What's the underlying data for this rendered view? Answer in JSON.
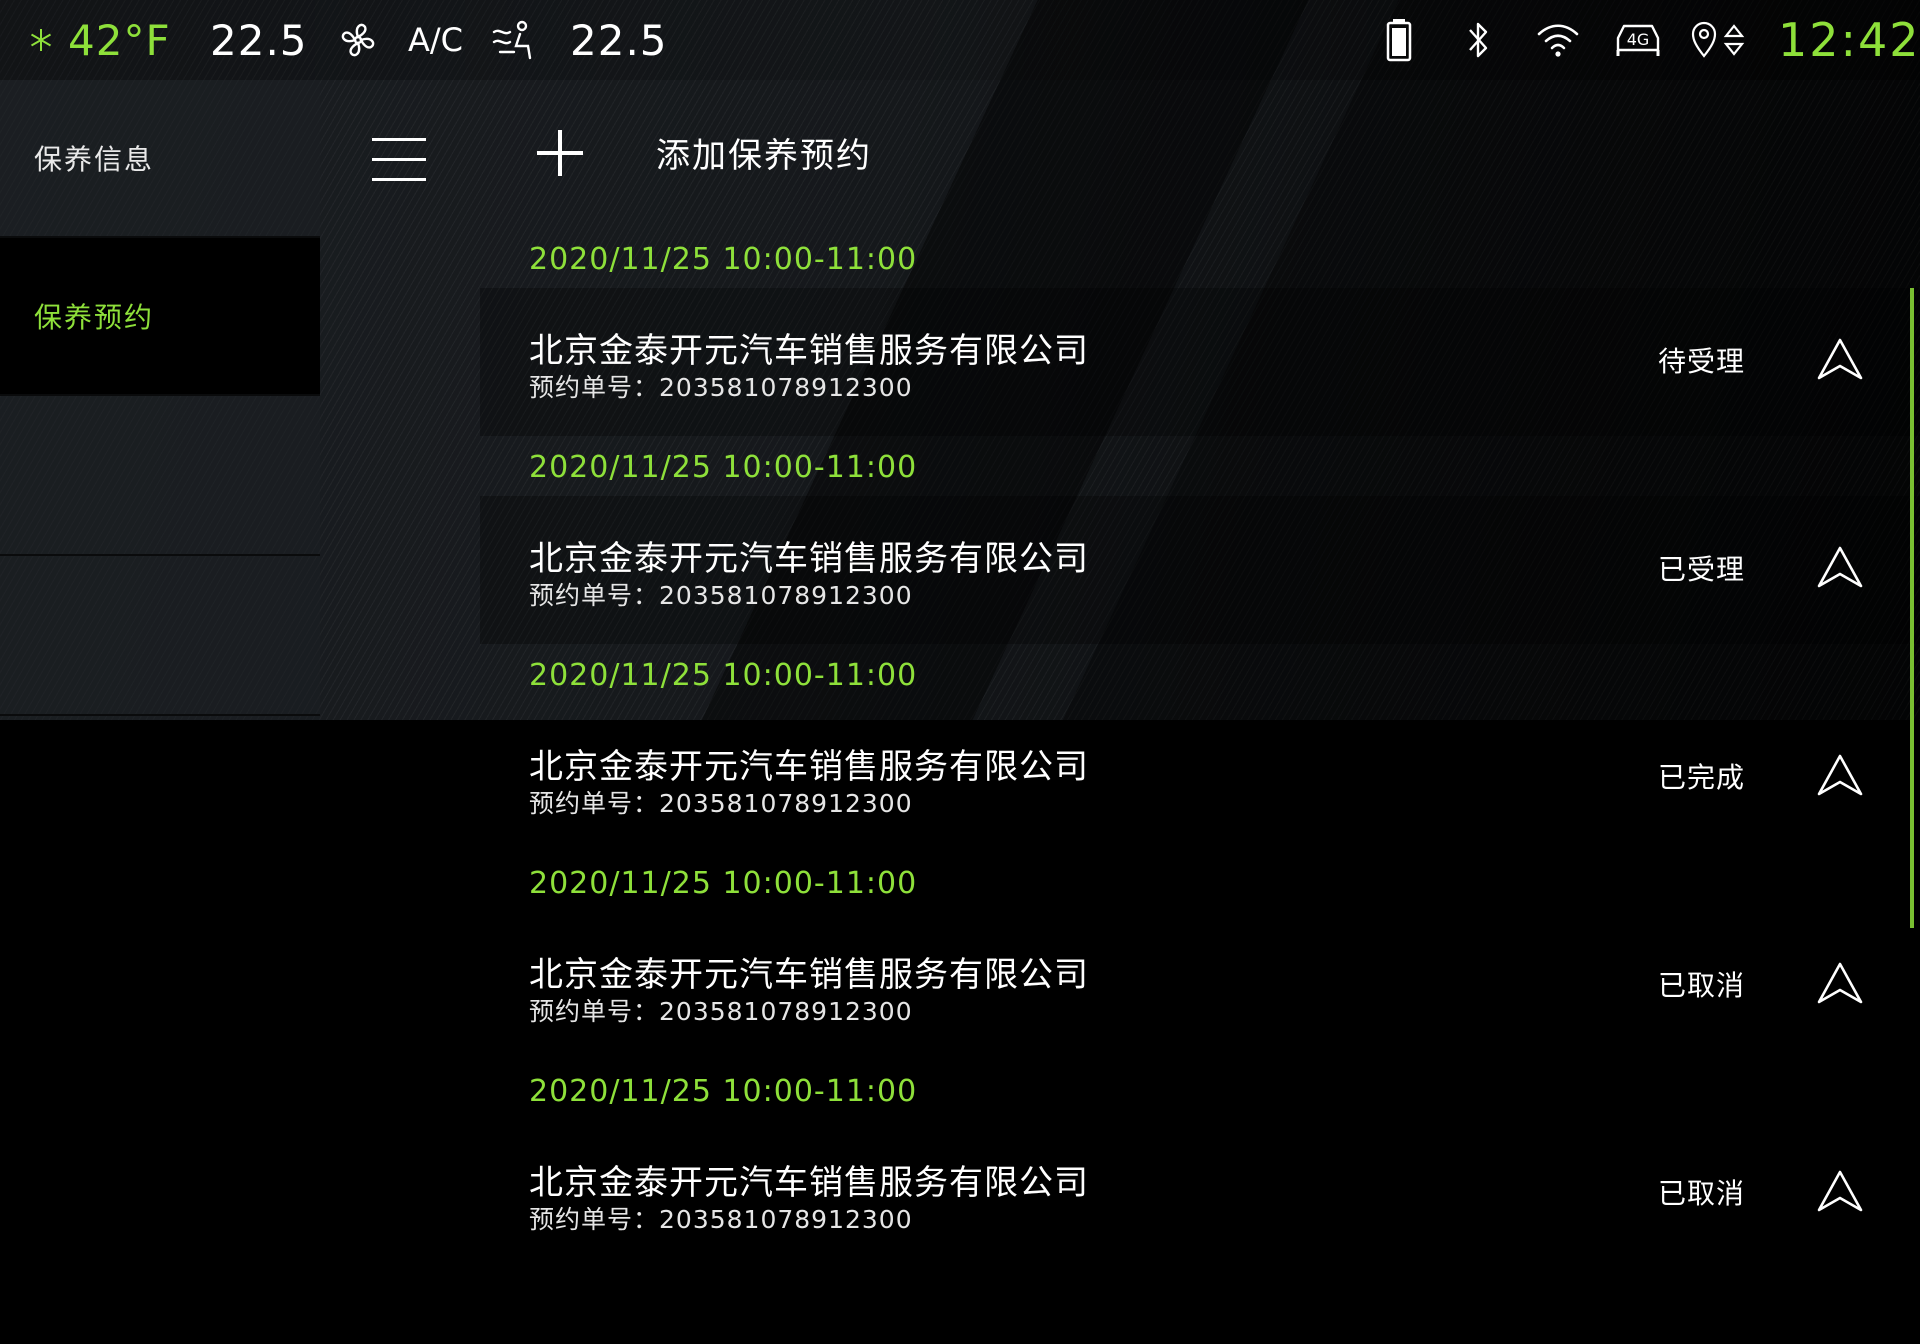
{
  "status_bar": {
    "outside_temp": "42°F",
    "left_temp": "22.5",
    "ac_label": "A/C",
    "right_temp": "22.5",
    "time": "12:42",
    "network_label": "4G"
  },
  "sidebar": {
    "items": [
      {
        "label": "保养信息",
        "active": false
      },
      {
        "label": "保养预约",
        "active": true
      }
    ]
  },
  "toolbar": {
    "add_label": "添加保养预约"
  },
  "appointments": [
    {
      "date": "2020/11/25 10:00-11:00",
      "company": "北京金泰开元汽车销售服务有限公司",
      "order_prefix": "预约单号：",
      "order_no": "203581078912300",
      "status": "待受理"
    },
    {
      "date": "2020/11/25 10:00-11:00",
      "company": "北京金泰开元汽车销售服务有限公司",
      "order_prefix": "预约单号：",
      "order_no": "203581078912300",
      "status": "已受理"
    },
    {
      "date": "2020/11/25 10:00-11:00",
      "company": "北京金泰开元汽车销售服务有限公司",
      "order_prefix": "预约单号：",
      "order_no": "203581078912300",
      "status": "已完成"
    },
    {
      "date": "2020/11/25 10:00-11:00",
      "company": "北京金泰开元汽车销售服务有限公司",
      "order_prefix": "预约单号：",
      "order_no": "203581078912300",
      "status": "已取消"
    },
    {
      "date": "2020/11/25 10:00-11:00",
      "company": "北京金泰开元汽车销售服务有限公司",
      "order_prefix": "预约单号：",
      "order_no": "203581078912300",
      "status": "已取消"
    }
  ],
  "colors": {
    "accent": "#8ee03a",
    "background": "#000000"
  }
}
